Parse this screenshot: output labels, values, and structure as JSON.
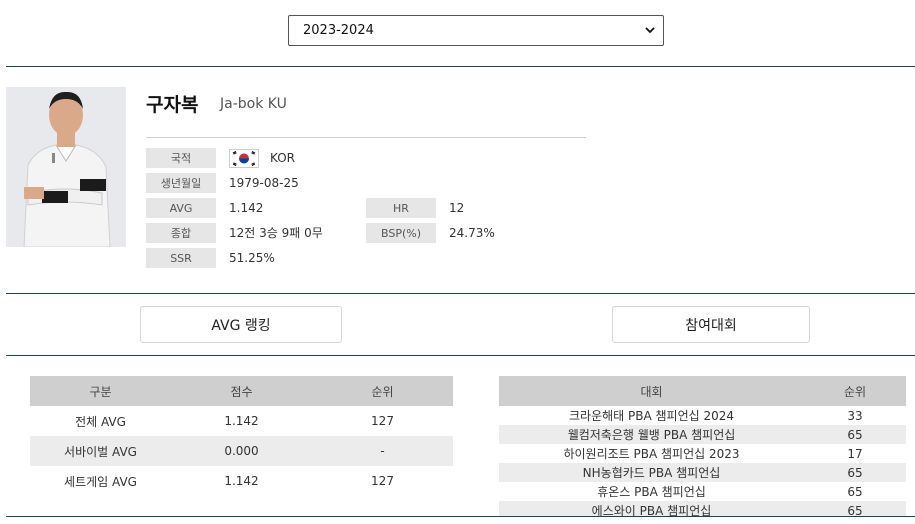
{
  "season_select": {
    "selected": "2023-2024"
  },
  "player": {
    "name_ko": "구자복",
    "name_en": "Ja-bok KU",
    "labels": {
      "nationality": "국적",
      "birthdate": "생년월일",
      "avg": "AVG",
      "hr": "HR",
      "record": "종합",
      "bsp": "BSP(%)",
      "ssr": "SSR"
    },
    "values": {
      "nationality": "KOR",
      "birthdate": "1979-08-25",
      "avg": "1.142",
      "hr": "12",
      "record": "12전 3승 9패 0무",
      "bsp": "24.73%",
      "ssr": "51.25%"
    }
  },
  "tabs": {
    "avg_ranking": "AVG 랭킹",
    "tournaments": "참여대회"
  },
  "avg_table": {
    "headers": [
      "구분",
      "점수",
      "순위"
    ],
    "rows": [
      [
        "전체 AVG",
        "1.142",
        "127"
      ],
      [
        "서바이벌 AVG",
        "0.000",
        "-"
      ],
      [
        "세트게임 AVG",
        "1.142",
        "127"
      ]
    ]
  },
  "tournament_table": {
    "headers": [
      "대회",
      "순위"
    ],
    "rows": [
      [
        "크라운해태 PBA 챔피언십 2024",
        "33"
      ],
      [
        "웰컴저축은행 웰뱅 PBA 챔피언십",
        "65"
      ],
      [
        "하이원리조트 PBA 챔피언십 2023",
        "17"
      ],
      [
        "NH농협카드 PBA 챔피언십",
        "65"
      ],
      [
        "휴온스 PBA 챔피언십",
        "65"
      ],
      [
        "에스와이 PBA 챔피언십",
        "65"
      ]
    ]
  },
  "colors": {
    "divider": "#1c3f66",
    "label_bg": "#e6e6e6",
    "table_header_bg": "#cfcfcf",
    "row_alt_bg": "#ececec"
  }
}
